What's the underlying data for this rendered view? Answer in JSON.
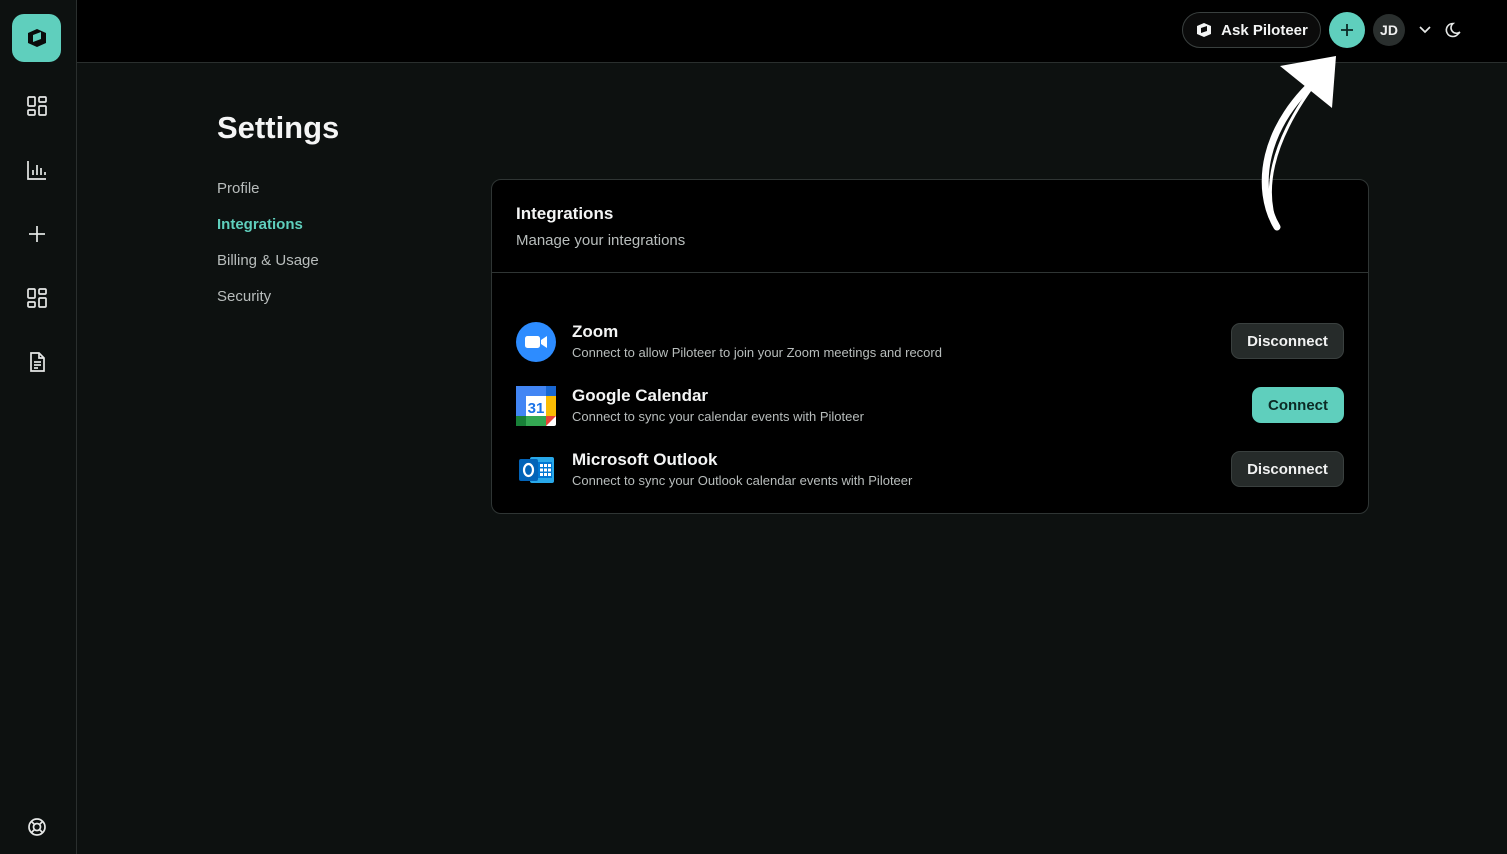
{
  "topbar": {
    "ask_label": "Ask Piloteer",
    "avatar_initials": "JD"
  },
  "settings": {
    "title": "Settings",
    "nav": [
      {
        "label": "Profile",
        "active": false
      },
      {
        "label": "Integrations",
        "active": true
      },
      {
        "label": "Billing & Usage",
        "active": false
      },
      {
        "label": "Security",
        "active": false
      }
    ]
  },
  "card": {
    "title": "Integrations",
    "subtitle": "Manage your integrations",
    "items": [
      {
        "name": "Zoom",
        "desc": "Connect to allow Piloteer to join your Zoom meetings and record",
        "action": "Disconnect",
        "icon": "zoom-icon"
      },
      {
        "name": "Google Calendar",
        "desc": "Connect to sync your calendar events with Piloteer",
        "action": "Connect",
        "icon": "google-calendar-icon",
        "calendar_day": "31"
      },
      {
        "name": "Microsoft Outlook",
        "desc": "Connect to sync your Outlook calendar events with Piloteer",
        "action": "Disconnect",
        "icon": "outlook-icon"
      }
    ]
  },
  "colors": {
    "accent": "#5fcfbd",
    "background": "#0d1110",
    "card": "#000000"
  }
}
